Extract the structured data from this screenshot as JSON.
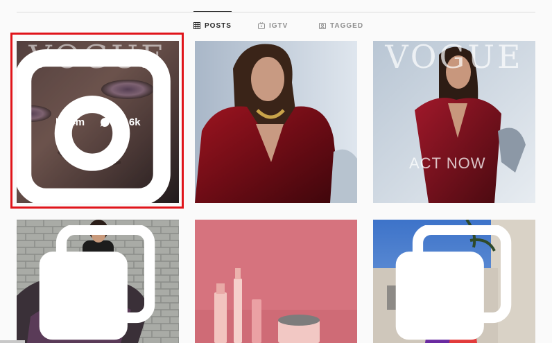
{
  "tabs": [
    {
      "label": "POSTS",
      "icon": "grid-icon",
      "active": true
    },
    {
      "label": "IGTV",
      "icon": "igtv-icon",
      "active": false
    },
    {
      "label": "TAGGED",
      "icon": "tagged-icon",
      "active": false
    }
  ],
  "highlight_color": "#e0141a",
  "posts": [
    {
      "id": "post-1",
      "magazine_title": "VOGUE",
      "icon": "photo-badge-icon",
      "hover": true,
      "views": "4m",
      "comments": "21.6k"
    },
    {
      "id": "post-2"
    },
    {
      "id": "post-3",
      "magazine_title": "VOGUE",
      "cover_text": "ACT NOW"
    },
    {
      "id": "post-4",
      "icon": "carousel-icon"
    },
    {
      "id": "post-5"
    },
    {
      "id": "post-6",
      "icon": "carousel-icon"
    }
  ]
}
